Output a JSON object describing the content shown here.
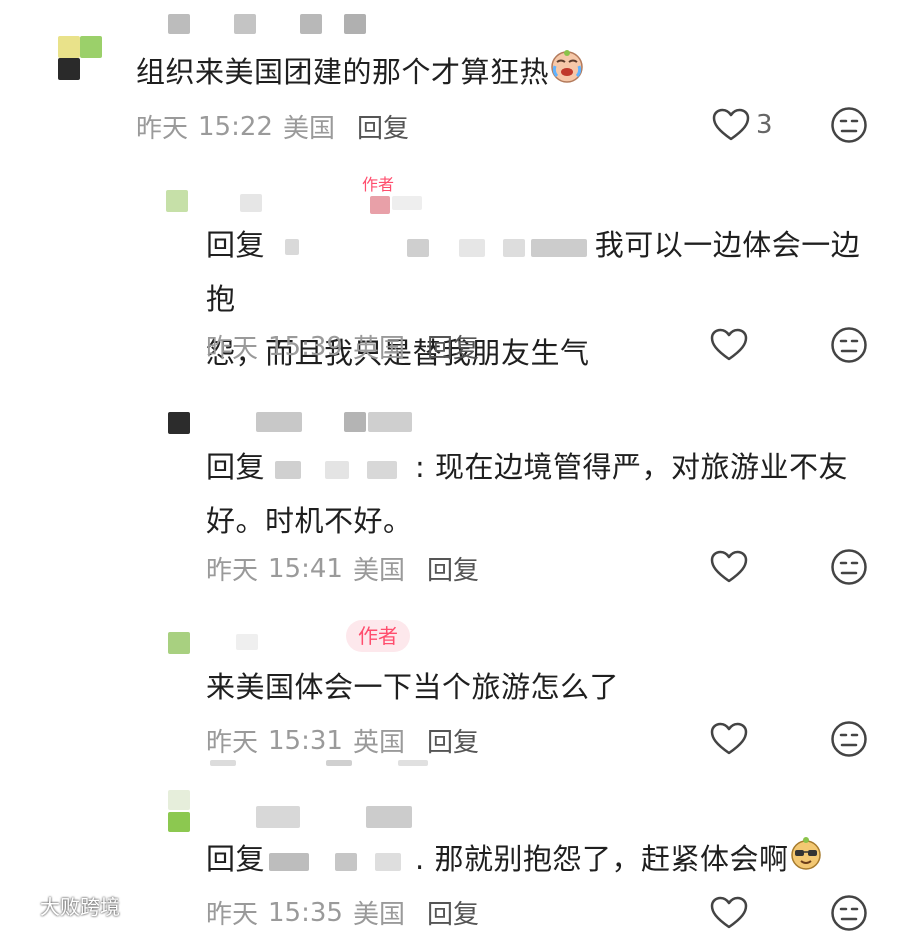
{
  "comments": [
    {
      "text": "组织来美国团建的那个才算狂热",
      "date": "昨天",
      "time": "15:22",
      "location": "美国",
      "reply_label": "回复",
      "likes": "3",
      "emoji": "crying-emoji"
    },
    {
      "reply_prefix": "回复",
      "text_line1": "我可以一边体会一边抱",
      "text_line2": "怨，而且我只是替我朋友生气",
      "date": "昨天",
      "time": "15:39",
      "location": "英国",
      "reply_label": "回复",
      "badge": "作者"
    },
    {
      "reply_prefix": "回复",
      "text_line1": ": 现在边境管得严，对旅游业不友",
      "text_line2": "好。时机不好。",
      "date": "昨天",
      "time": "15:41",
      "location": "美国",
      "reply_label": "回复"
    },
    {
      "badge": "作者",
      "text": "来美国体会一下当个旅游怎么了",
      "date": "昨天",
      "time": "15:31",
      "location": "英国",
      "reply_label": "回复"
    },
    {
      "reply_prefix": "回复",
      "text": ". 那就别抱怨了，赶紧体会啊",
      "date": "昨天",
      "time": "15:35",
      "location": "美国",
      "reply_label": "回复",
      "emoji": "sunglasses-emoji"
    }
  ],
  "watermark": "大败跨境",
  "colors": {
    "accent": "#ff4d6d",
    "meta": "#9a9a9a",
    "text": "#1f1f1f"
  }
}
